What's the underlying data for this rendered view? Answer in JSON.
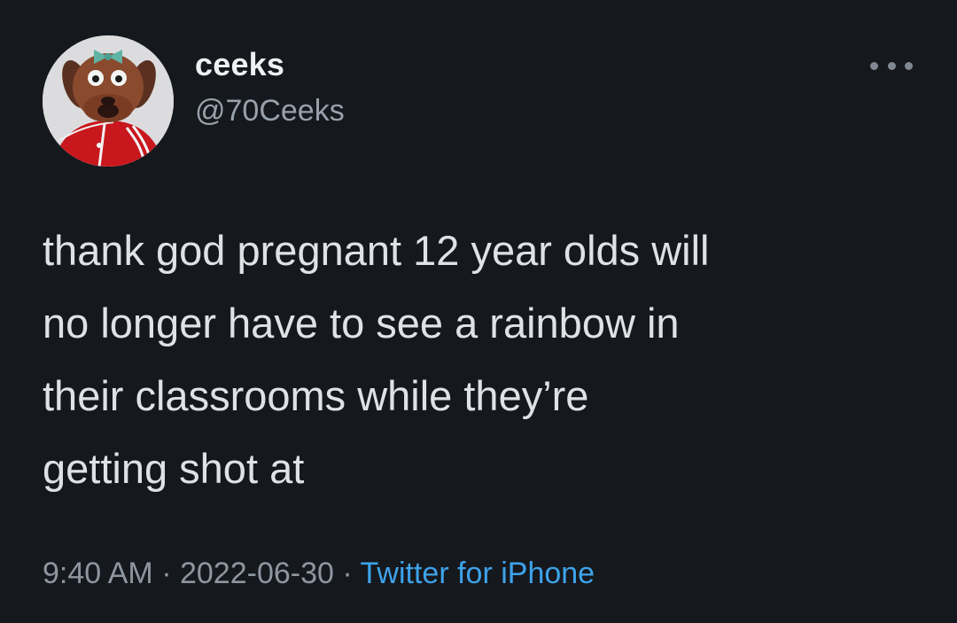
{
  "user": {
    "display_name": "ceeks",
    "handle": "@70Ceeks",
    "avatar_icon": "puppet-avatar"
  },
  "menu": {
    "icon": "more-options-icon"
  },
  "tweet": {
    "text": "thank god pregnant 12 year olds will\nno longer have to see a rainbow in\ntheir classrooms while they’re\ngetting shot at"
  },
  "meta": {
    "time": "9:40 AM",
    "separator": "·",
    "date": "2022-06-30",
    "source": "Twitter for iPhone"
  },
  "colors": {
    "background": "#15181d",
    "source_link": "#3ea3ea"
  }
}
